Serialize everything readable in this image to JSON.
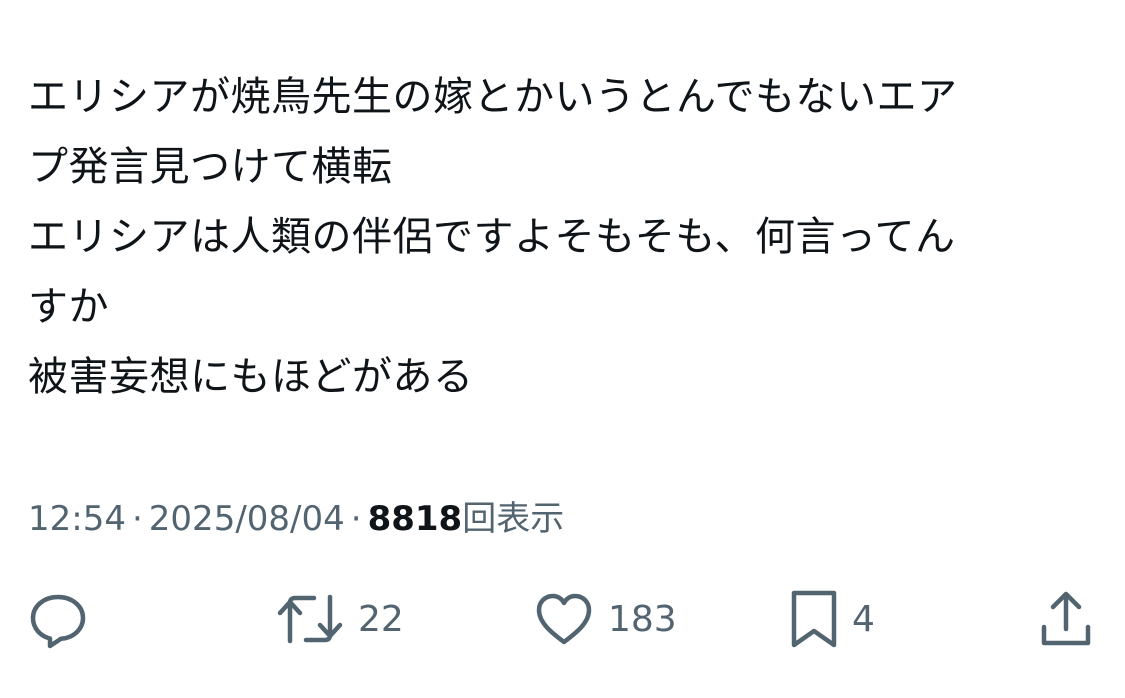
{
  "tweet": {
    "lines": [
      "エリシアが焼鳥先生の嫁とかいうとんでもないエア",
      "プ発言見つけて横転",
      "エリシアは人類の伴侶ですよそもそも、何言ってん",
      "すか",
      "被害妄想にもほどがある"
    ]
  },
  "meta": {
    "time": "12:54",
    "separator": "·",
    "date": "2025/08/04",
    "views_count": "8818",
    "views_label": "回表示"
  },
  "actions": {
    "reply": {
      "icon": "reply-icon",
      "count": ""
    },
    "retweet": {
      "icon": "retweet-icon",
      "count": "22"
    },
    "like": {
      "icon": "heart-icon",
      "count": "183"
    },
    "bookmark": {
      "icon": "bookmark-icon",
      "count": "4"
    },
    "share": {
      "icon": "share-icon"
    }
  },
  "colors": {
    "text": "#0f1419",
    "secondary": "#536471",
    "background": "#ffffff"
  }
}
